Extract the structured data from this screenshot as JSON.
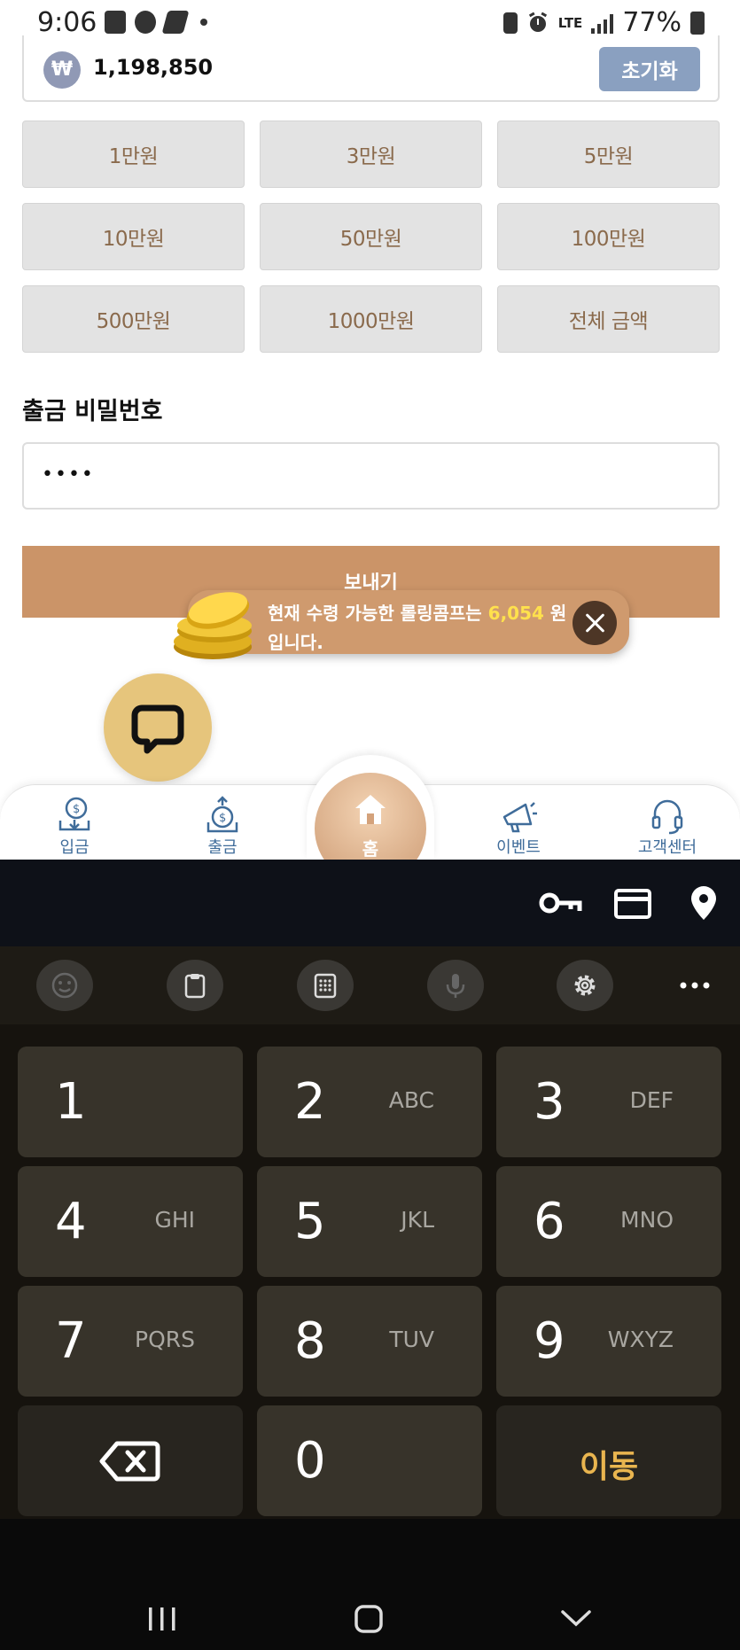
{
  "status_bar": {
    "time": "9:06",
    "network": "LTE",
    "battery": "77%"
  },
  "amount": {
    "currency_symbol": "₩",
    "value": "1,198,850",
    "reset_label": "초기화"
  },
  "quick_amounts": [
    "1만원",
    "3만원",
    "5만원",
    "10만원",
    "50만원",
    "100만원",
    "500만원",
    "1000만원",
    "전체 금액"
  ],
  "password": {
    "label": "출금 비밀번호",
    "value": "••••"
  },
  "send_label": "보내기",
  "toast": {
    "prefix": "현재 수령 가능한 롤링콤프는 ",
    "amount": "6,054",
    "suffix_line1": " 원",
    "line2": "입니다."
  },
  "bottom_nav": {
    "deposit": "입금",
    "withdraw": "출금",
    "home": "홈",
    "event": "이벤트",
    "support": "고객센터"
  },
  "keyboard": {
    "keys": [
      {
        "num": "1",
        "letters": ""
      },
      {
        "num": "2",
        "letters": "ABC"
      },
      {
        "num": "3",
        "letters": "DEF"
      },
      {
        "num": "4",
        "letters": "GHI"
      },
      {
        "num": "5",
        "letters": "JKL"
      },
      {
        "num": "6",
        "letters": "MNO"
      },
      {
        "num": "7",
        "letters": "PQRS"
      },
      {
        "num": "8",
        "letters": "TUV"
      },
      {
        "num": "9",
        "letters": "WXYZ"
      }
    ],
    "zero": "0",
    "go_label": "이동"
  },
  "colors": {
    "accent": "#cb9468",
    "nav_blue": "#3f6c9a",
    "reset_blue": "#8aa0c0",
    "toast_amount": "#ffe14d",
    "go_key": "#e9b54f"
  }
}
